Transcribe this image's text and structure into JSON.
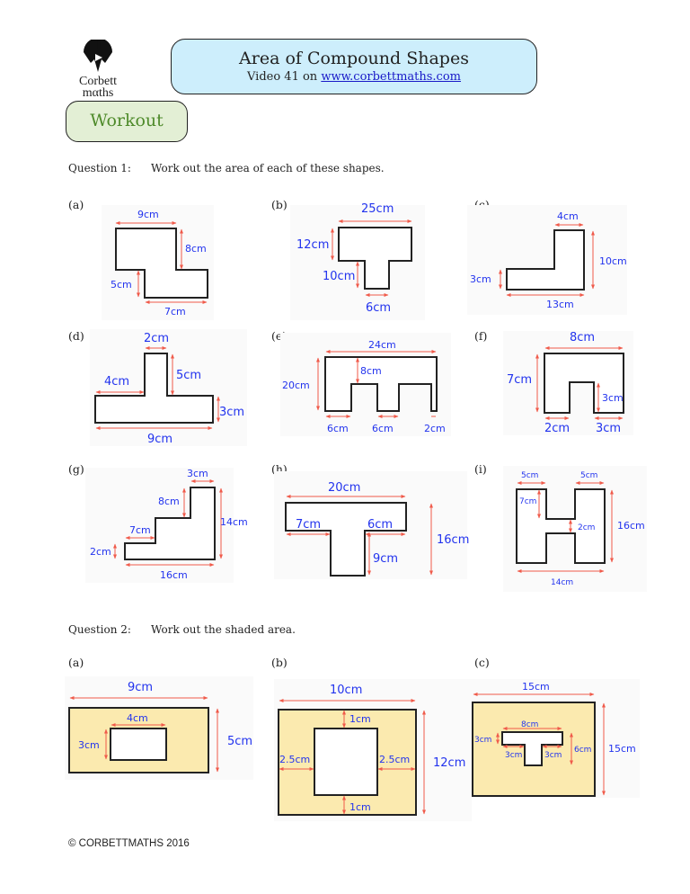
{
  "header": {
    "logo_line1": "Corbett",
    "logo_line2": "mαths",
    "title": "Area of Compound Shapes",
    "subtitle_prefix": "Video 41 on ",
    "subtitle_link": "www.corbettmaths.com",
    "section_badge": "Workout"
  },
  "colors": {
    "title_box_bg": "#cdeefc",
    "workout_box_bg": "#e3efd5",
    "workout_text": "#4e8a2a",
    "dimension_text": "#2233ee",
    "dimension_arrow": "#f05a4a",
    "shaded_fill": "#fbeaaf",
    "link": "#1a1ac8"
  },
  "question1": {
    "number": "Question 1:",
    "prompt": "Work out the area of each of these shapes.",
    "parts": [
      {
        "label": "(a)",
        "dims": [
          "9cm",
          "8cm",
          "5cm",
          "7cm"
        ]
      },
      {
        "label": "(b)",
        "dims": [
          "25cm",
          "12cm",
          "10cm",
          "6cm"
        ]
      },
      {
        "label": "(c)",
        "dims": [
          "4cm",
          "10cm",
          "3cm",
          "13cm"
        ]
      },
      {
        "label": "(d)",
        "dims": [
          "2cm",
          "5cm",
          "4cm",
          "3cm",
          "9cm"
        ]
      },
      {
        "label": "(e)",
        "dims": [
          "24cm",
          "8cm",
          "20cm",
          "6cm",
          "6cm",
          "2cm"
        ]
      },
      {
        "label": "(f)",
        "dims": [
          "8cm",
          "7cm",
          "3cm",
          "2cm",
          "3cm"
        ]
      },
      {
        "label": "(g)",
        "dims": [
          "3cm",
          "8cm",
          "14cm",
          "7cm",
          "2cm",
          "16cm"
        ]
      },
      {
        "label": "(h)",
        "dims": [
          "20cm",
          "7cm",
          "6cm",
          "16cm",
          "9cm"
        ]
      },
      {
        "label": "(i)",
        "dims": [
          "5cm",
          "5cm",
          "7cm",
          "2cm",
          "16cm",
          "14cm"
        ]
      }
    ]
  },
  "question2": {
    "number": "Question 2:",
    "prompt": "Work out the shaded area.",
    "parts": [
      {
        "label": "(a)",
        "dims": [
          "9cm",
          "4cm",
          "3cm",
          "5cm"
        ]
      },
      {
        "label": "(b)",
        "dims": [
          "10cm",
          "1cm",
          "2.5cm",
          "2.5cm",
          "12cm",
          "1cm"
        ]
      },
      {
        "label": "(c)",
        "dims": [
          "15cm",
          "8cm",
          "3cm",
          "6cm",
          "15cm",
          "3cm",
          "3cm"
        ]
      }
    ]
  },
  "footer": {
    "copyright": "© CORBETTMATHS 2016"
  }
}
